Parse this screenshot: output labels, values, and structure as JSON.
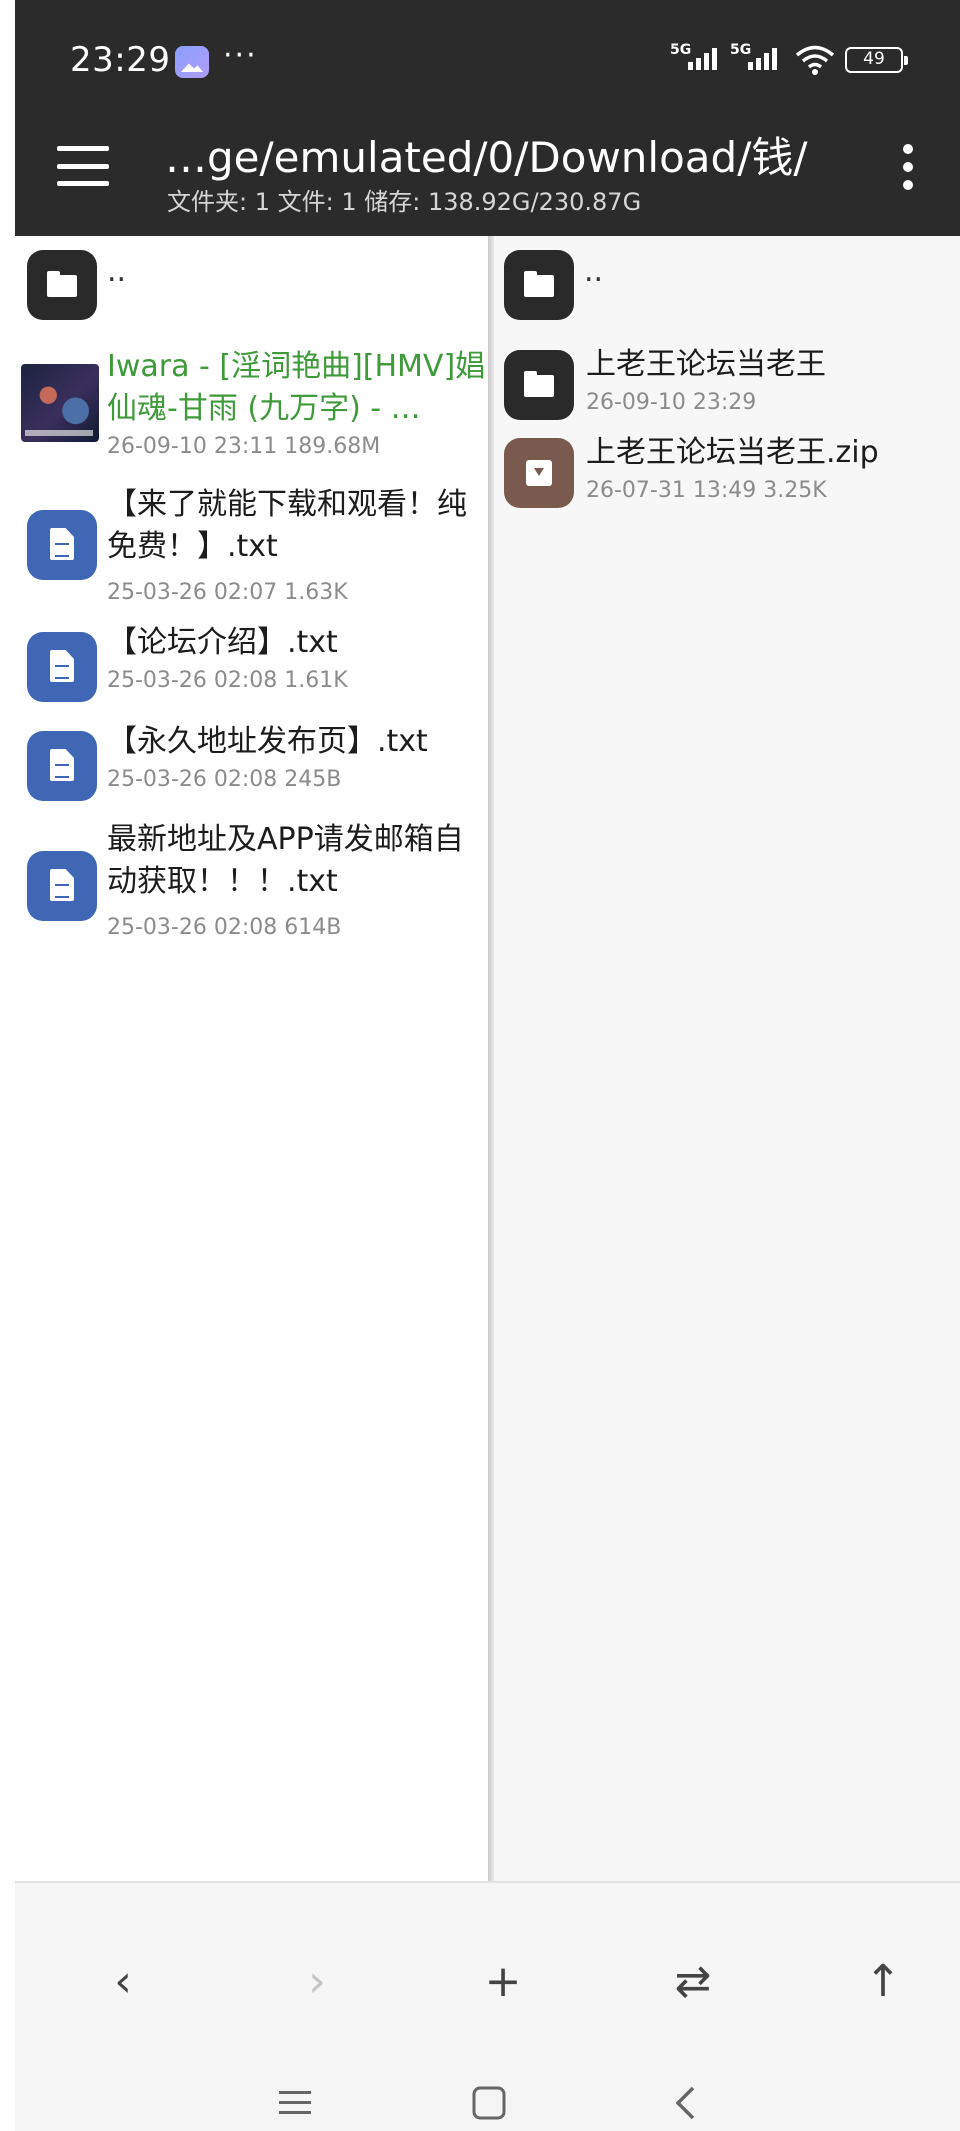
{
  "status_bar": {
    "time": "23:29",
    "more": "···",
    "signal1_label": "5G",
    "signal2_label": "5G",
    "battery": "49",
    "icons": [
      "gallery-icon",
      "signal-icon",
      "signal-icon",
      "wifi-icon",
      "battery-icon"
    ]
  },
  "toolbar": {
    "path": "…ge/emulated/0/Download/钱/",
    "summary": "文件夹: 1  文件: 1  储存: 138.92G/230.87G",
    "icons": [
      "menu-icon",
      "more-vert-icon"
    ]
  },
  "left_pane": {
    "parent": "..",
    "items": [
      {
        "name": "Iwara - [淫词艳曲][HMV]娼仙魂-甘雨 (九万字) - …",
        "meta": "26-09-10 23:11  189.68M",
        "icon": "video-thumbnail",
        "highlight_color": "#3f9a3a"
      },
      {
        "name": "【来了就能下载和观看！纯免费！】.txt",
        "meta": "25-03-26 02:07  1.63K",
        "icon": "text-file-icon"
      },
      {
        "name": "【论坛介绍】.txt",
        "meta": "25-03-26 02:08  1.61K",
        "icon": "text-file-icon"
      },
      {
        "name": "【永久地址发布页】.txt",
        "meta": "25-03-26 02:08  245B",
        "icon": "text-file-icon"
      },
      {
        "name": "最新地址及APP请发邮箱自动获取！！！.txt",
        "meta": "25-03-26 02:08  614B",
        "icon": "text-file-icon"
      }
    ]
  },
  "right_pane": {
    "parent": "..",
    "items": [
      {
        "name": "上老王论坛当老王",
        "meta": "26-09-10 23:29",
        "icon": "folder-icon"
      },
      {
        "name": "上老王论坛当老王.zip",
        "meta": "26-07-31 13:49  3.25K",
        "icon": "archive-icon"
      }
    ]
  },
  "bottom_bar": {
    "back": "‹",
    "forward": "›",
    "add": "+",
    "swap": "⇄",
    "up": "↑"
  },
  "nav_bar": {
    "icons": [
      "recents-icon",
      "home-icon",
      "back-icon"
    ]
  },
  "colors": {
    "appbar": "#2b2b2b",
    "doc_icon": "#3f67b5",
    "archive_icon": "#7a5a4e",
    "highlight_text": "#3f9a3a"
  }
}
